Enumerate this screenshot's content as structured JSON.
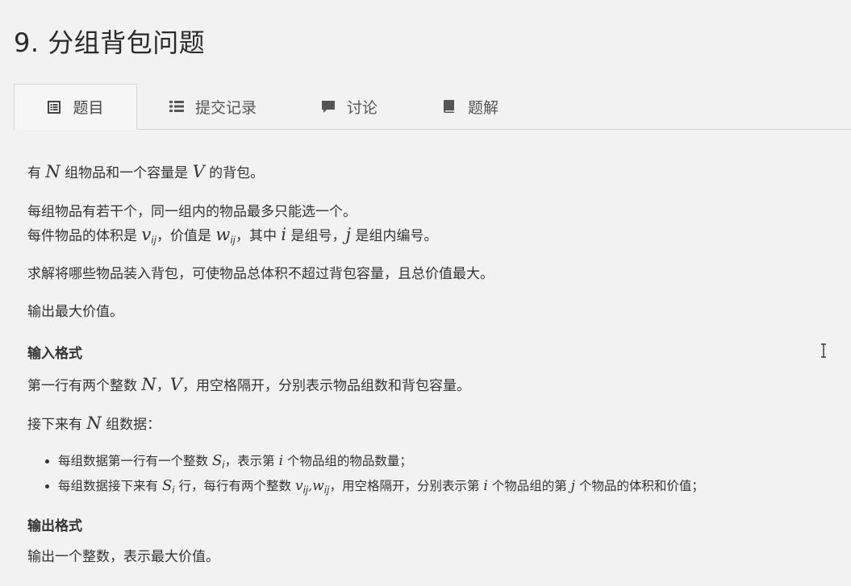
{
  "title": "9. 分组背包问题",
  "tabs": [
    {
      "label": "题目",
      "icon": "doc-icon",
      "active": true
    },
    {
      "label": "提交记录",
      "icon": "list-icon",
      "active": false
    },
    {
      "label": "讨论",
      "icon": "comment-icon",
      "active": false
    },
    {
      "label": "题解",
      "icon": "book-icon",
      "active": false
    }
  ],
  "problem": {
    "p1": {
      "a": "有 ",
      "N": "N",
      "b": " 组物品和一个容量是 ",
      "V": "V",
      "c": " 的背包。"
    },
    "p2_line1": "每组物品有若干个，同一组内的物品最多只能选一个。",
    "p2_line2": {
      "a": "每件物品的体积是 ",
      "v": "v",
      "v_sub": "ij",
      "b": "，价值是 ",
      "w": "w",
      "w_sub": "ij",
      "c": "，其中 ",
      "i": "i",
      "d": " 是组号，",
      "j": "j",
      "e": " 是组内编号。"
    },
    "p3": "求解将哪些物品装入背包，可使物品总体积不超过背包容量，且总价值最大。",
    "p4": "输出最大价值。",
    "input_heading": "输入格式",
    "input_p1": {
      "a": "第一行有两个整数 ",
      "N": "N",
      "comma": "，",
      "V": "V",
      "b": "，用空格隔开，分别表示物品组数和背包容量。"
    },
    "input_p2": {
      "a": "接下来有 ",
      "N": "N",
      "b": " 组数据："
    },
    "bullets": {
      "b1": {
        "a": "每组数据第一行有一个整数 ",
        "S": "S",
        "S_sub": "i",
        "b": "，表示第 ",
        "i": "i",
        "c": " 个物品组的物品数量；"
      },
      "b2": {
        "a": "每组数据接下来有 ",
        "S": "S",
        "S_sub": "i",
        "b": " 行，每行有两个整数 ",
        "v": "v",
        "v_sub": "ij",
        "sep": ",",
        "w": "w",
        "w_sub": "ij",
        "c": "，用空格隔开，分别表示第 ",
        "i": "i",
        "d": " 个物品组的第 ",
        "j": "j",
        "e": " 个物品的体积和价值；"
      }
    },
    "output_heading": "输出格式",
    "output_p1": "输出一个整数，表示最大价值。"
  },
  "cursor": {
    "icon": "text-cursor-icon"
  }
}
